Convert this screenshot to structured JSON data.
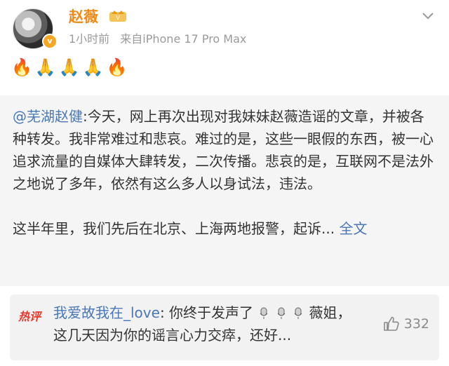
{
  "post": {
    "username": "赵薇",
    "time": "1小时前",
    "source": "来自iPhone 17 Pro Max",
    "emojis": "🔥🙏🙏🙏🔥"
  },
  "repost": {
    "mention": "@芜湖赵健",
    "text_before": ":今天，网上再次出现对我妹妹赵薇造谣的文章，并被各种转发。我非常难过和悲哀。难过的是，这些一眼假的东西，被一心追求流量的自媒体大肆转发，二次传播。悲哀的是，互联网不是法外之地说了多年，依然有这么多人以身试法，违法。",
    "text_second": "这半年里，我们先后在北京、上海两地报警，起诉...",
    "full_text_link": "全文"
  },
  "hot_comment": {
    "badge": "热评",
    "user": "我爱故我在_love",
    "text_a": ": 你终于发声了",
    "text_b": "薇姐，这几天因为你的谣言心力交瘁，还好...",
    "likes": "332"
  },
  "icons": {
    "more": "chevron-down-icon",
    "like": "thumb-up-icon",
    "mic": "microphone-icon",
    "vip": "crown-icon"
  },
  "colors": {
    "username": "#ee8a18",
    "link": "#4a77b8",
    "hot": "#e6382b"
  }
}
